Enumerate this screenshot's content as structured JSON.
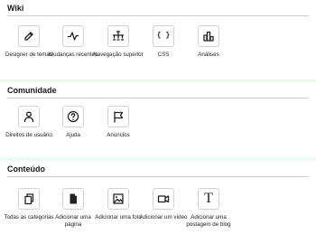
{
  "sections": {
    "wiki": {
      "title": "Wiki",
      "items": [
        {
          "label": "Designer de temas",
          "icon": "brush-icon"
        },
        {
          "label": "Mudanças recentes",
          "icon": "activity-icon"
        },
        {
          "label": "Navegação superior",
          "icon": "sitemap-icon"
        },
        {
          "label": "CSS",
          "icon": "code-braces-icon"
        },
        {
          "label": "Análises",
          "icon": "bar-chart-icon"
        }
      ]
    },
    "comunidade": {
      "title": "Comunidade",
      "items": [
        {
          "label": "Direitos de usuário",
          "icon": "user-icon"
        },
        {
          "label": "Ajuda",
          "icon": "help-circle-icon"
        },
        {
          "label": "Anúncios",
          "icon": "flag-icon"
        }
      ]
    },
    "conteudo": {
      "title": "Conteúdo",
      "items": [
        {
          "label": "Todas as categorias",
          "icon": "pages-icon"
        },
        {
          "label": "Adicionar uma página",
          "icon": "page-add-icon"
        },
        {
          "label": "Adicionar uma foto",
          "icon": "image-icon"
        },
        {
          "label": "Adicionar um vídeo",
          "icon": "video-icon"
        },
        {
          "label": "Adicionar uma postagem de blog",
          "icon": "text-icon"
        }
      ]
    }
  },
  "icon_glyphs": {
    "css": "{ }",
    "blog": "T"
  }
}
